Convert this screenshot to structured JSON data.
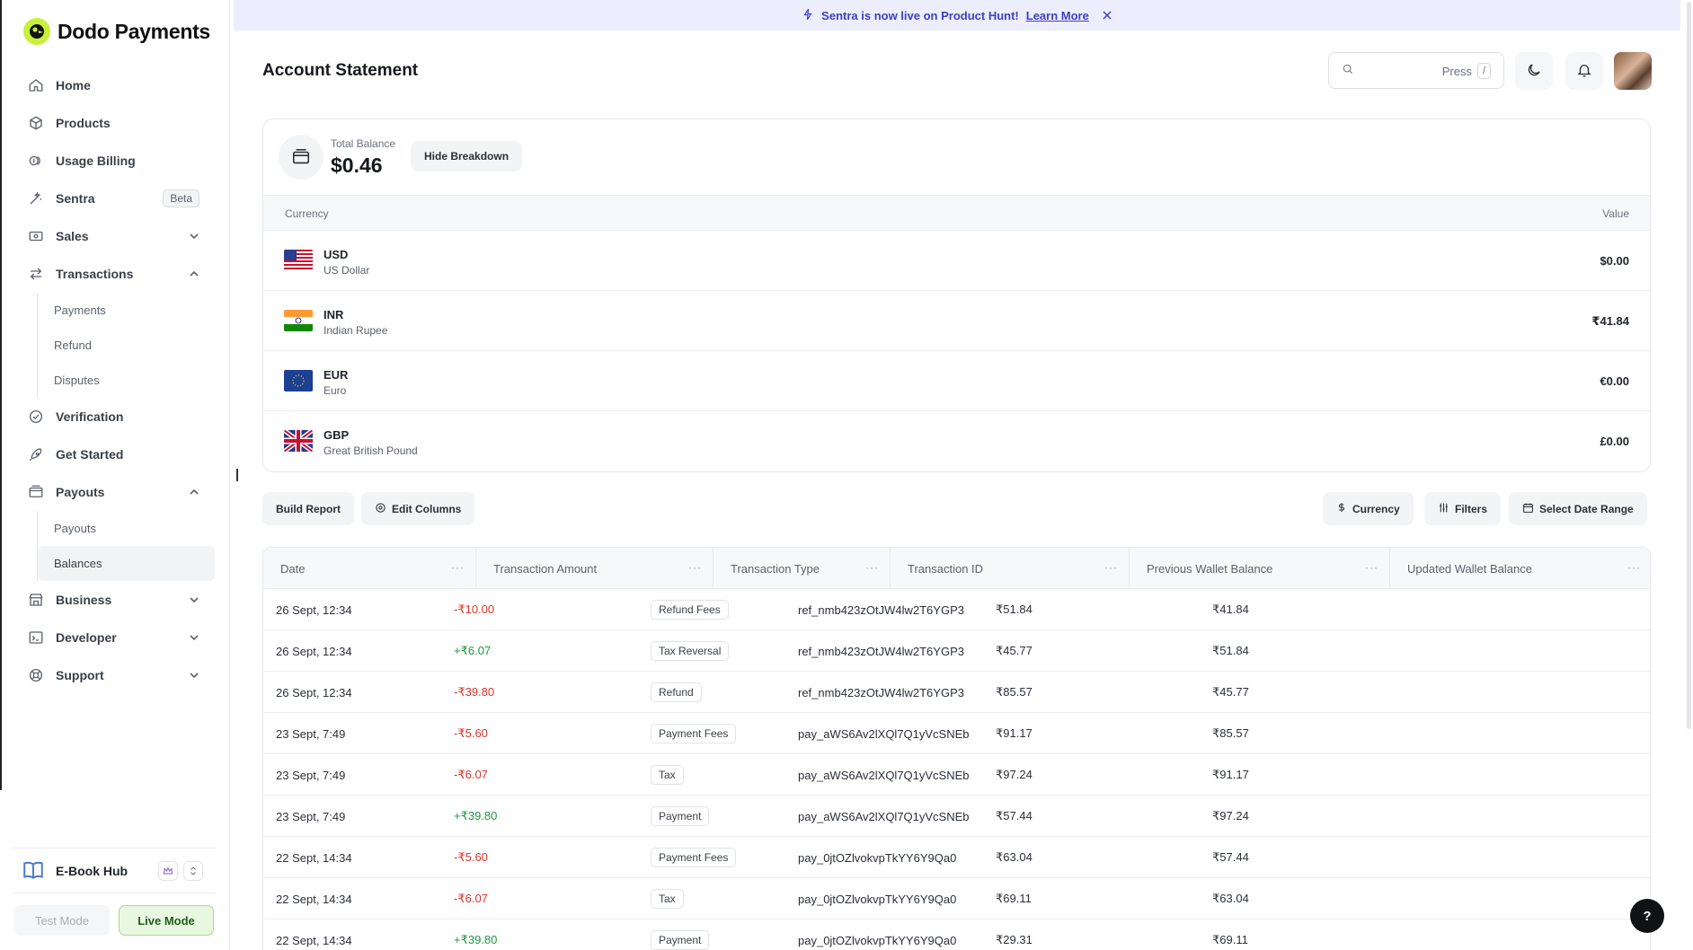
{
  "app": {
    "name": "Dodo Payments"
  },
  "banner": {
    "message": "Sentra is now live on Product Hunt!",
    "link": "Learn More"
  },
  "sidebar": {
    "items": [
      {
        "label": "Home"
      },
      {
        "label": "Products"
      },
      {
        "label": "Usage Billing"
      },
      {
        "label": "Sentra",
        "badge": "Beta"
      },
      {
        "label": "Sales"
      },
      {
        "label": "Transactions",
        "children": [
          "Payments",
          "Refund",
          "Disputes"
        ]
      },
      {
        "label": "Verification"
      },
      {
        "label": "Get Started"
      },
      {
        "label": "Payouts",
        "children": [
          "Payouts",
          "Balances"
        ],
        "active_child": "Balances"
      },
      {
        "label": "Business"
      },
      {
        "label": "Developer"
      },
      {
        "label": "Support"
      }
    ],
    "workspace": {
      "name": "E-Book Hub"
    },
    "modes": {
      "test": "Test Mode",
      "live": "Live Mode"
    }
  },
  "header": {
    "title": "Account Statement",
    "search": {
      "placeholder": "",
      "hint": "Press",
      "shortcut": "/"
    }
  },
  "balance": {
    "label": "Total Balance",
    "value": "$0.46",
    "toggle": "Hide Breakdown",
    "columns": {
      "currency": "Currency",
      "value": "Value"
    },
    "currencies": [
      {
        "code": "USD",
        "name": "US Dollar",
        "value": "$0.00",
        "flag": "us-flag"
      },
      {
        "code": "INR",
        "name": "Indian Rupee",
        "value": "₹41.84",
        "flag": "india-flag"
      },
      {
        "code": "EUR",
        "name": "Euro",
        "value": "€0.00",
        "flag": "eu-flag"
      },
      {
        "code": "GBP",
        "name": "Great British Pound",
        "value": "£0.00",
        "flag": "uk-flag"
      }
    ]
  },
  "toolbar": {
    "build_report": "Build Report",
    "edit_columns": "Edit Columns",
    "currency": "Currency",
    "filters": "Filters",
    "date_range": "Select Date Range"
  },
  "table": {
    "columns": [
      "Date",
      "Transaction Amount",
      "Transaction Type",
      "Transaction ID",
      "Previous Wallet Balance",
      "Updated Wallet Balance"
    ],
    "rows": [
      {
        "date": "26 Sept, 12:34",
        "amount": "-₹10.00",
        "type": "Refund Fees",
        "id": "ref_nmb423zOtJW4lw2T6YGP3",
        "prev": "₹51.84",
        "updated": "₹41.84"
      },
      {
        "date": "26 Sept, 12:34",
        "amount": "+₹6.07",
        "type": "Tax Reversal",
        "id": "ref_nmb423zOtJW4lw2T6YGP3",
        "prev": "₹45.77",
        "updated": "₹51.84"
      },
      {
        "date": "26 Sept, 12:34",
        "amount": "-₹39.80",
        "type": "Refund",
        "id": "ref_nmb423zOtJW4lw2T6YGP3",
        "prev": "₹85.57",
        "updated": "₹45.77"
      },
      {
        "date": "23 Sept, 7:49",
        "amount": "-₹5.60",
        "type": "Payment Fees",
        "id": "pay_aWS6Av2lXQl7Q1yVcSNEb",
        "prev": "₹91.17",
        "updated": "₹85.57"
      },
      {
        "date": "23 Sept, 7:49",
        "amount": "-₹6.07",
        "type": "Tax",
        "id": "pay_aWS6Av2lXQl7Q1yVcSNEb",
        "prev": "₹97.24",
        "updated": "₹91.17"
      },
      {
        "date": "23 Sept, 7:49",
        "amount": "+₹39.80",
        "type": "Payment",
        "id": "pay_aWS6Av2lXQl7Q1yVcSNEb",
        "prev": "₹57.44",
        "updated": "₹97.24"
      },
      {
        "date": "22 Sept, 14:34",
        "amount": "-₹5.60",
        "type": "Payment Fees",
        "id": "pay_0jtOZlvokvpTkYY6Y9Qa0",
        "prev": "₹63.04",
        "updated": "₹57.44"
      },
      {
        "date": "22 Sept, 14:34",
        "amount": "-₹6.07",
        "type": "Tax",
        "id": "pay_0jtOZlvokvpTkYY6Y9Qa0",
        "prev": "₹69.11",
        "updated": "₹63.04"
      },
      {
        "date": "22 Sept, 14:34",
        "amount": "+₹39.80",
        "type": "Payment",
        "id": "pay_0jtOZlvokvpTkYY6Y9Qa0",
        "prev": "₹29.31",
        "updated": "₹69.11"
      }
    ]
  },
  "help": {
    "label": "?"
  },
  "colors": {
    "brand": "#c8ef3a",
    "banner_bg": "#eceefd",
    "banner_text": "#3f3fc4",
    "negative": "#d9362b",
    "positive": "#1e9a3f",
    "live_mode": "#e8f7df"
  }
}
